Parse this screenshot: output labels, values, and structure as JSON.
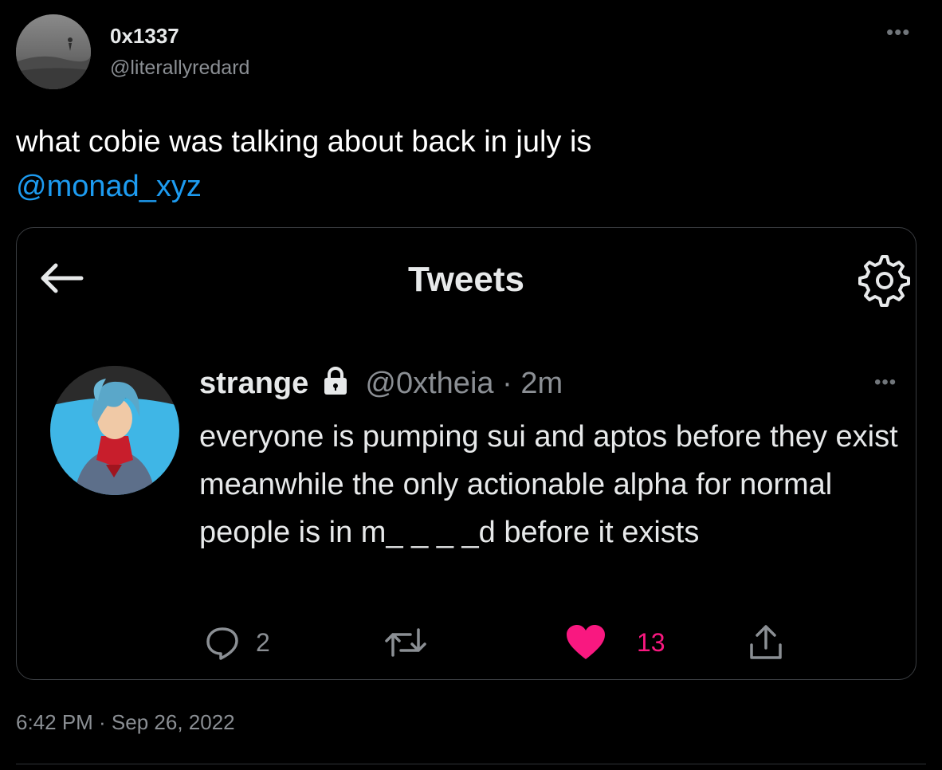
{
  "tweet": {
    "author": {
      "name": "0x1337",
      "handle": "@literallyredard"
    },
    "more_icon": "more-horizontal-icon",
    "text": "what cobie was talking about back in july is",
    "mention": "@monad_xyz",
    "timestamp": "6:42 PM · Sep 26, 2022"
  },
  "embed": {
    "header": {
      "title": "Tweets",
      "back_icon": "arrow-left-icon",
      "settings_icon": "gear-icon"
    },
    "quoted": {
      "name": "strange",
      "lock_icon": "lock-icon",
      "handle": "@0xtheia",
      "separator": "·",
      "time": "2m",
      "text": "everyone is pumping sui and aptos before they exist meanwhile the only actionable alpha for normal people is in m_ _ _ _d before it exists",
      "actions": {
        "reply_count": "2",
        "retweet_count": "",
        "like_count": "13"
      }
    }
  },
  "colors": {
    "background": "#000000",
    "text": "#e7e9ea",
    "secondary": "#8b8f94",
    "link": "#1d9bf0",
    "like": "#f91880",
    "border": "#3a3d41"
  }
}
